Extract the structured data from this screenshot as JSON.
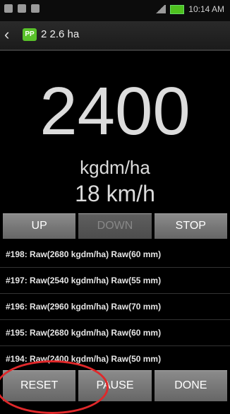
{
  "status": {
    "time": "10:14 AM"
  },
  "actionbar": {
    "back_icon": "chevron-left-icon",
    "badge": "PP",
    "title": "2 2.6 ha"
  },
  "reading": {
    "rate": "2400",
    "unit": "kgdm/ha",
    "speed": "18 km/h"
  },
  "controls": {
    "up": "UP",
    "down": "DOWN",
    "stop": "STOP"
  },
  "log": [
    "#198: Raw(2680 kgdm/ha)  Raw(60 mm)",
    "#197: Raw(2540 kgdm/ha)  Raw(55 mm)",
    "#196: Raw(2960 kgdm/ha)  Raw(70 mm)",
    "#195: Raw(2680 kgdm/ha)  Raw(60 mm)",
    "#194: Raw(2400 kgdm/ha)  Raw(50 mm)"
  ],
  "bottom": {
    "reset": "RESET",
    "pause": "PAUSE",
    "done": "DONE"
  },
  "colors": {
    "badge": "#59c22a",
    "annotation": "#e0282a"
  }
}
